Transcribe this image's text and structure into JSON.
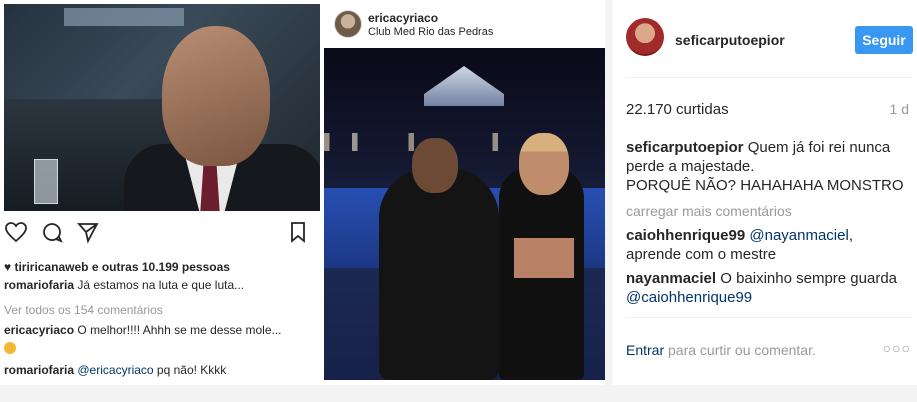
{
  "left_post": {
    "likes_user": "tiriricanaweb",
    "likes_rest": " e outras 10.199 pessoas",
    "comment1_user": "romariofaria",
    "comment1_text": " Já estamos na luta e que luta...",
    "view_all": "Ver todos os 154 comentários",
    "comment2_user": "ericacyriaco",
    "comment2_text": " O melhor!!!! Ahhh se me desse mole...",
    "comment3_user": "romariofaria",
    "comment3_mention": "@ericacyriaco",
    "comment3_text": " pq não! Kkkk"
  },
  "right_post": {
    "username": "ericacyriaco",
    "location": "Club Med Rio das Pedras"
  },
  "panel": {
    "username": "seficarputoepior",
    "follow_label": "Seguir",
    "likes": "22.170 curtidas",
    "time": "1 d",
    "caption_user": "seficarputoepior",
    "caption_line1": " Quem já foi rei nunca",
    "caption_line2": "perde a majestade.",
    "caption_line3": "PORQUÊ NÃO? HAHAHAHA MONSTRO",
    "load_more": "carregar mais comentários",
    "comment1_user": "caiohhenrique99",
    "comment1_mention": "@nayanmaciel",
    "comment1_after": ",",
    "comment1_line2": "aprende com o mestre",
    "comment2_user": "nayanmaciel",
    "comment2_text": " O baixinho sempre guarda",
    "comment2_mention": "@caiohhenrique99",
    "login_link": "Entrar",
    "login_text": " para curtir ou comentar.",
    "more_dots": "○○○"
  },
  "colors": {
    "accent": "#3897f0",
    "link": "#003569",
    "muted": "#999999"
  },
  "icons": [
    "heart-icon",
    "comment-icon",
    "share-icon",
    "bookmark-icon"
  ]
}
